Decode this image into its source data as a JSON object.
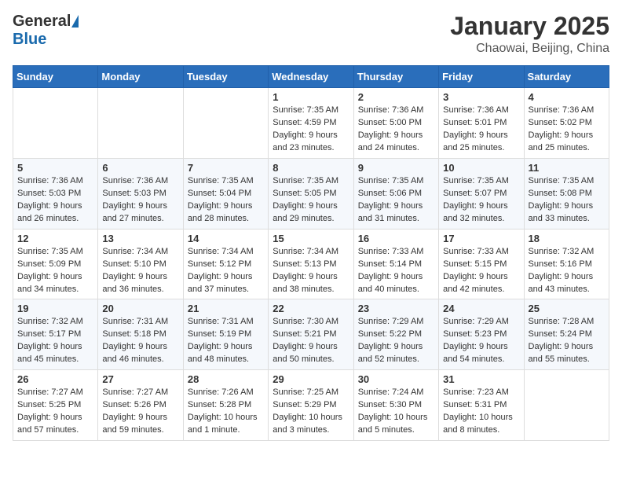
{
  "header": {
    "logo_general": "General",
    "logo_blue": "Blue",
    "month": "January 2025",
    "location": "Chaowai, Beijing, China"
  },
  "days_of_week": [
    "Sunday",
    "Monday",
    "Tuesday",
    "Wednesday",
    "Thursday",
    "Friday",
    "Saturday"
  ],
  "weeks": [
    [
      {
        "day": "",
        "detail": ""
      },
      {
        "day": "",
        "detail": ""
      },
      {
        "day": "",
        "detail": ""
      },
      {
        "day": "1",
        "detail": "Sunrise: 7:35 AM\nSunset: 4:59 PM\nDaylight: 9 hours\nand 23 minutes."
      },
      {
        "day": "2",
        "detail": "Sunrise: 7:36 AM\nSunset: 5:00 PM\nDaylight: 9 hours\nand 24 minutes."
      },
      {
        "day": "3",
        "detail": "Sunrise: 7:36 AM\nSunset: 5:01 PM\nDaylight: 9 hours\nand 25 minutes."
      },
      {
        "day": "4",
        "detail": "Sunrise: 7:36 AM\nSunset: 5:02 PM\nDaylight: 9 hours\nand 25 minutes."
      }
    ],
    [
      {
        "day": "5",
        "detail": "Sunrise: 7:36 AM\nSunset: 5:03 PM\nDaylight: 9 hours\nand 26 minutes."
      },
      {
        "day": "6",
        "detail": "Sunrise: 7:36 AM\nSunset: 5:03 PM\nDaylight: 9 hours\nand 27 minutes."
      },
      {
        "day": "7",
        "detail": "Sunrise: 7:35 AM\nSunset: 5:04 PM\nDaylight: 9 hours\nand 28 minutes."
      },
      {
        "day": "8",
        "detail": "Sunrise: 7:35 AM\nSunset: 5:05 PM\nDaylight: 9 hours\nand 29 minutes."
      },
      {
        "day": "9",
        "detail": "Sunrise: 7:35 AM\nSunset: 5:06 PM\nDaylight: 9 hours\nand 31 minutes."
      },
      {
        "day": "10",
        "detail": "Sunrise: 7:35 AM\nSunset: 5:07 PM\nDaylight: 9 hours\nand 32 minutes."
      },
      {
        "day": "11",
        "detail": "Sunrise: 7:35 AM\nSunset: 5:08 PM\nDaylight: 9 hours\nand 33 minutes."
      }
    ],
    [
      {
        "day": "12",
        "detail": "Sunrise: 7:35 AM\nSunset: 5:09 PM\nDaylight: 9 hours\nand 34 minutes."
      },
      {
        "day": "13",
        "detail": "Sunrise: 7:34 AM\nSunset: 5:10 PM\nDaylight: 9 hours\nand 36 minutes."
      },
      {
        "day": "14",
        "detail": "Sunrise: 7:34 AM\nSunset: 5:12 PM\nDaylight: 9 hours\nand 37 minutes."
      },
      {
        "day": "15",
        "detail": "Sunrise: 7:34 AM\nSunset: 5:13 PM\nDaylight: 9 hours\nand 38 minutes."
      },
      {
        "day": "16",
        "detail": "Sunrise: 7:33 AM\nSunset: 5:14 PM\nDaylight: 9 hours\nand 40 minutes."
      },
      {
        "day": "17",
        "detail": "Sunrise: 7:33 AM\nSunset: 5:15 PM\nDaylight: 9 hours\nand 42 minutes."
      },
      {
        "day": "18",
        "detail": "Sunrise: 7:32 AM\nSunset: 5:16 PM\nDaylight: 9 hours\nand 43 minutes."
      }
    ],
    [
      {
        "day": "19",
        "detail": "Sunrise: 7:32 AM\nSunset: 5:17 PM\nDaylight: 9 hours\nand 45 minutes."
      },
      {
        "day": "20",
        "detail": "Sunrise: 7:31 AM\nSunset: 5:18 PM\nDaylight: 9 hours\nand 46 minutes."
      },
      {
        "day": "21",
        "detail": "Sunrise: 7:31 AM\nSunset: 5:19 PM\nDaylight: 9 hours\nand 48 minutes."
      },
      {
        "day": "22",
        "detail": "Sunrise: 7:30 AM\nSunset: 5:21 PM\nDaylight: 9 hours\nand 50 minutes."
      },
      {
        "day": "23",
        "detail": "Sunrise: 7:29 AM\nSunset: 5:22 PM\nDaylight: 9 hours\nand 52 minutes."
      },
      {
        "day": "24",
        "detail": "Sunrise: 7:29 AM\nSunset: 5:23 PM\nDaylight: 9 hours\nand 54 minutes."
      },
      {
        "day": "25",
        "detail": "Sunrise: 7:28 AM\nSunset: 5:24 PM\nDaylight: 9 hours\nand 55 minutes."
      }
    ],
    [
      {
        "day": "26",
        "detail": "Sunrise: 7:27 AM\nSunset: 5:25 PM\nDaylight: 9 hours\nand 57 minutes."
      },
      {
        "day": "27",
        "detail": "Sunrise: 7:27 AM\nSunset: 5:26 PM\nDaylight: 9 hours\nand 59 minutes."
      },
      {
        "day": "28",
        "detail": "Sunrise: 7:26 AM\nSunset: 5:28 PM\nDaylight: 10 hours\nand 1 minute."
      },
      {
        "day": "29",
        "detail": "Sunrise: 7:25 AM\nSunset: 5:29 PM\nDaylight: 10 hours\nand 3 minutes."
      },
      {
        "day": "30",
        "detail": "Sunrise: 7:24 AM\nSunset: 5:30 PM\nDaylight: 10 hours\nand 5 minutes."
      },
      {
        "day": "31",
        "detail": "Sunrise: 7:23 AM\nSunset: 5:31 PM\nDaylight: 10 hours\nand 8 minutes."
      },
      {
        "day": "",
        "detail": ""
      }
    ]
  ]
}
